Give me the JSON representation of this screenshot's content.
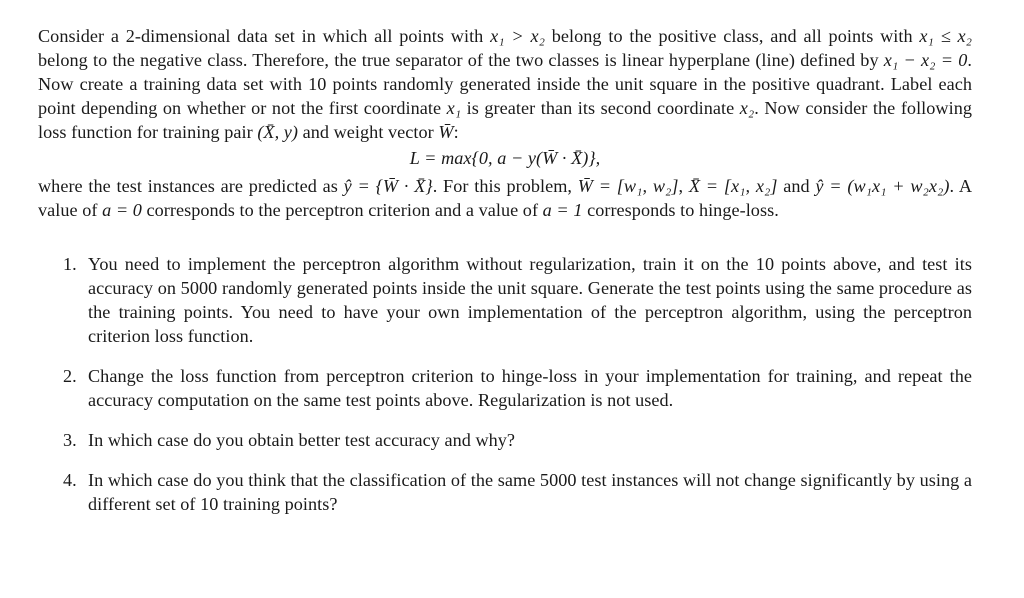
{
  "intro": {
    "p1": [
      "Consider a 2-dimensional data set in which all points with ",
      " belong to the positive class, and all points with ",
      " belong to the negative class. Therefore, the true separator of the two classes is linear hyperplane (line) defined by ",
      ". Now create a training data set with 10 points randomly generated inside the unit square in the positive quadrant. Label each point depending on whether or not the first coordinate ",
      " is greater than its second coordinate ",
      ". Now consider the following loss function for training pair ",
      " and weight vector ",
      ":"
    ],
    "math": {
      "cond_pos": "x₁ > x₂",
      "cond_neg": "x₁ ≤ x₂",
      "separator": "x₁ − x₂ = 0",
      "x1": "x₁",
      "x2": "x₂",
      "pair": "(X̄, y)",
      "W": "W̄"
    }
  },
  "equation": "L = max{0, a − y(W̄ · X̄)},",
  "p2": [
    "where the test instances are predicted as ",
    ". For this problem, ",
    ", ",
    " and ",
    ". A value of ",
    " corresponds to the perceptron criterion and a value of ",
    " corresponds to hinge-loss."
  ],
  "p2_math": {
    "yhat_def": "ŷ = {W̄ · X̄}",
    "W_def": "W̄ = [w₁, w₂]",
    "X_def": "X̄ = [x₁, x₂]",
    "yhat_expr": "ŷ = (w₁x₁ + w₂x₂)",
    "a0": "a = 0",
    "a1": "a = 1"
  },
  "questions": [
    {
      "num": "1.",
      "text": "You need to implement the perceptron algorithm without regularization, train it on the 10 points above, and test its accuracy on 5000 randomly generated points inside the unit square. Generate the test points using the same procedure as the training points. You need to have your own implementation of the perceptron algorithm, using the perceptron criterion loss function."
    },
    {
      "num": "2.",
      "text": "Change the loss function from perceptron criterion to hinge-loss in your implementation for training, and repeat the accuracy computation on the same test points above. Regularization is not used."
    },
    {
      "num": "3.",
      "text": "In which case do you obtain better test accuracy and why?"
    },
    {
      "num": "4.",
      "text": "In which case do you think that the classification of the same 5000 test instances will not change significantly by using a different set of 10 training points?"
    }
  ]
}
